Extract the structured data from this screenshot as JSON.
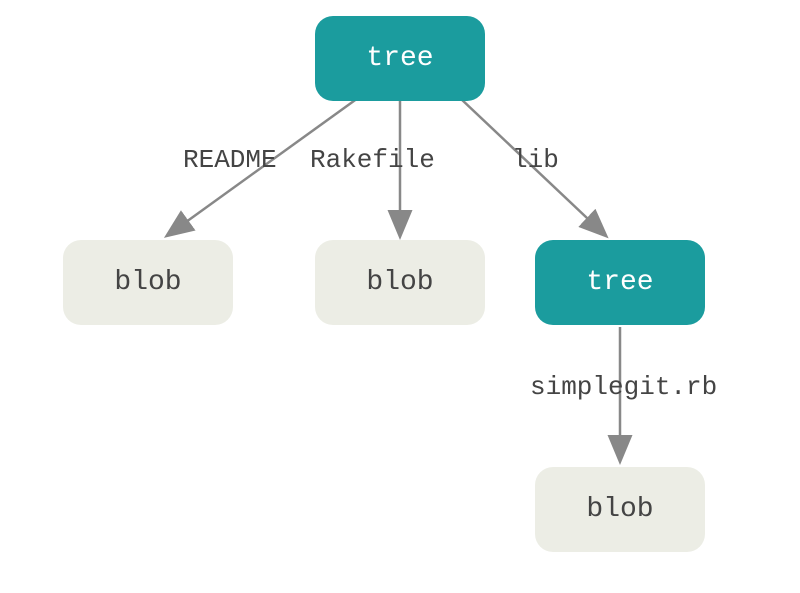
{
  "nodes": {
    "root_tree": {
      "label": "tree",
      "type": "tree"
    },
    "blob_readme": {
      "label": "blob",
      "type": "blob"
    },
    "blob_rakefile": {
      "label": "blob",
      "type": "blob"
    },
    "sub_tree": {
      "label": "tree",
      "type": "tree"
    },
    "blob_simplegit": {
      "label": "blob",
      "type": "blob"
    }
  },
  "edges": {
    "readme": {
      "label": "README"
    },
    "rakefile": {
      "label": "Rakefile"
    },
    "lib": {
      "label": "lib"
    },
    "simplegit": {
      "label": "simplegit.rb"
    }
  },
  "colors": {
    "tree_bg": "#1b9c9e",
    "blob_bg": "#ecede5",
    "arrow": "#888888",
    "text_dark": "#444444"
  }
}
